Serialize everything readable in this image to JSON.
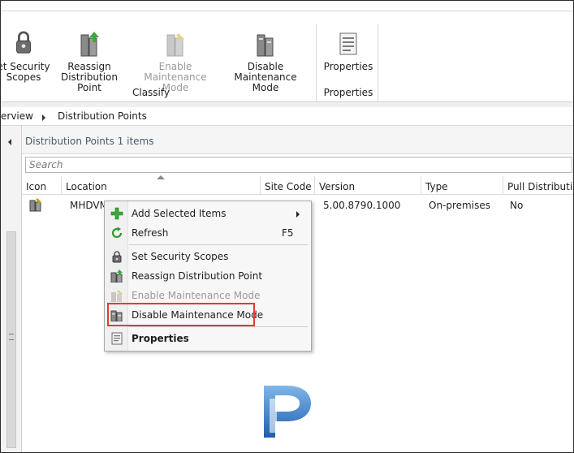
{
  "ribbon": {
    "buttons": [
      {
        "label1": "et Security",
        "label2": "Scopes",
        "icon": "lock-icon",
        "enabled": true
      },
      {
        "label1": "Reassign",
        "label2": "Distribution Point",
        "icon": "server-arrow-icon",
        "enabled": true
      },
      {
        "label1": "Enable",
        "label2": "Maintenance Mode",
        "icon": "server-wrench-icon",
        "enabled": false
      },
      {
        "label1": "Disable",
        "label2": "Maintenance Mode",
        "icon": "server-disable-icon",
        "enabled": true
      },
      {
        "label1": "Properties",
        "label2": "",
        "icon": "properties-icon",
        "enabled": true
      }
    ],
    "groups": {
      "classify": "Classify",
      "properties": "Properties"
    }
  },
  "breadcrumb": {
    "part1": "erview",
    "part2": "Distribution Points"
  },
  "main": {
    "title": "Distribution Points 1 items",
    "search_placeholder": "Search",
    "columns": [
      "Icon",
      "Location",
      "Site Code",
      "Version",
      "Type",
      "Pull Distribution"
    ],
    "row": {
      "location": "MHDVM",
      "version": "5.00.8790.1000",
      "type": "On-premises",
      "pull": "No"
    }
  },
  "context_menu": {
    "items": [
      {
        "label": "Add Selected Items",
        "shortcut": "",
        "icon": "green-plus-icon",
        "submenu": true
      },
      {
        "label": "Refresh",
        "shortcut": "F5",
        "icon": "refresh-icon"
      },
      {
        "label": "Set Security Scopes",
        "icon": "lock-icon"
      },
      {
        "label": "Reassign Distribution Point",
        "icon": "server-arrow-icon"
      },
      {
        "label": "Enable Maintenance Mode",
        "icon": "server-wrench-icon",
        "disabled": true
      },
      {
        "label": "Disable Maintenance Mode",
        "icon": "server-disable-icon"
      },
      {
        "label": "Properties",
        "icon": "properties-icon",
        "bold": true
      }
    ]
  },
  "colors": {
    "highlight": "#e53935",
    "logo": "#2a6db5"
  }
}
